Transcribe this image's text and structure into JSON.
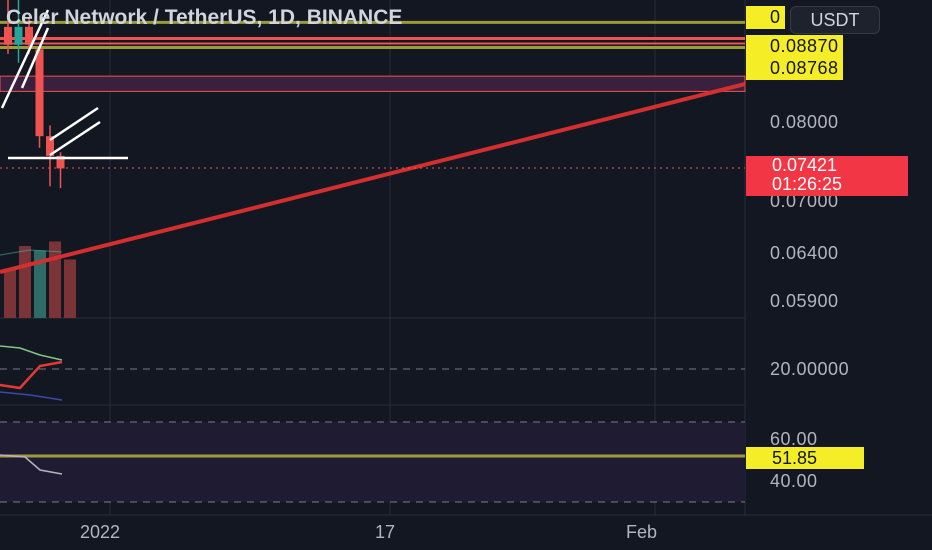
{
  "header": {
    "title": "Celer Network / TetherUS, 1D, BINANCE",
    "scale_button": "USDT",
    "top_cut_label": "0"
  },
  "price_axis": {
    "levels": [
      {
        "label": "0.08870",
        "style": "tag"
      },
      {
        "label": "0.08768",
        "style": "tag"
      },
      {
        "label": "0.08000",
        "style": "plain"
      },
      {
        "label": "0.07000",
        "style": "plain"
      },
      {
        "label": "0.06400",
        "style": "plain"
      },
      {
        "label": "0.05900",
        "style": "plain"
      }
    ],
    "current_price": "0.07421",
    "countdown": "01:26:25"
  },
  "indicator_axis": {
    "adx_level": "20.00000",
    "rsi_upper": "60.00",
    "rsi_value": "51.85",
    "rsi_lower": "40.00"
  },
  "time_axis": {
    "labels": [
      "2022",
      "17",
      "Feb"
    ]
  },
  "colors": {
    "background": "#131722",
    "up": "#26a69a",
    "down": "#ef5350",
    "trendline": "#d32f2f",
    "yellow_level": "#9b9b3a",
    "tag_yellow": "#f5ee26",
    "price_tag": "#f23645"
  },
  "chart_data": {
    "type": "candlestick",
    "title": "Celer Network / TetherUS, 1D, BINANCE",
    "candles": [
      {
        "open": 0.09,
        "high": 0.0935,
        "low": 0.087,
        "close": 0.088,
        "direction": "down"
      },
      {
        "open": 0.088,
        "high": 0.095,
        "low": 0.086,
        "close": 0.09,
        "direction": "up"
      },
      {
        "open": 0.09,
        "high": 0.091,
        "low": 0.087,
        "close": 0.088,
        "direction": "down"
      },
      {
        "open": 0.0875,
        "high": 0.0875,
        "low": 0.0765,
        "close": 0.0778,
        "direction": "down"
      },
      {
        "open": 0.0778,
        "high": 0.079,
        "low": 0.0722,
        "close": 0.0756,
        "direction": "down"
      },
      {
        "open": 0.0756,
        "high": 0.076,
        "low": 0.072,
        "close": 0.0742,
        "direction": "down"
      }
    ],
    "volume": [
      {
        "value": 0.55,
        "direction": "down"
      },
      {
        "value": 0.8,
        "direction": "down"
      },
      {
        "value": 0.75,
        "direction": "up"
      },
      {
        "value": 0.85,
        "direction": "down"
      },
      {
        "value": 0.65,
        "direction": "down"
      }
    ],
    "horizontal_levels": [
      0.0905,
      0.0887,
      0.0877
    ],
    "zone": [
      0.0845,
      0.0828
    ],
    "ylim": [
      0.0575,
      0.093
    ],
    "last_price": 0.07421
  }
}
